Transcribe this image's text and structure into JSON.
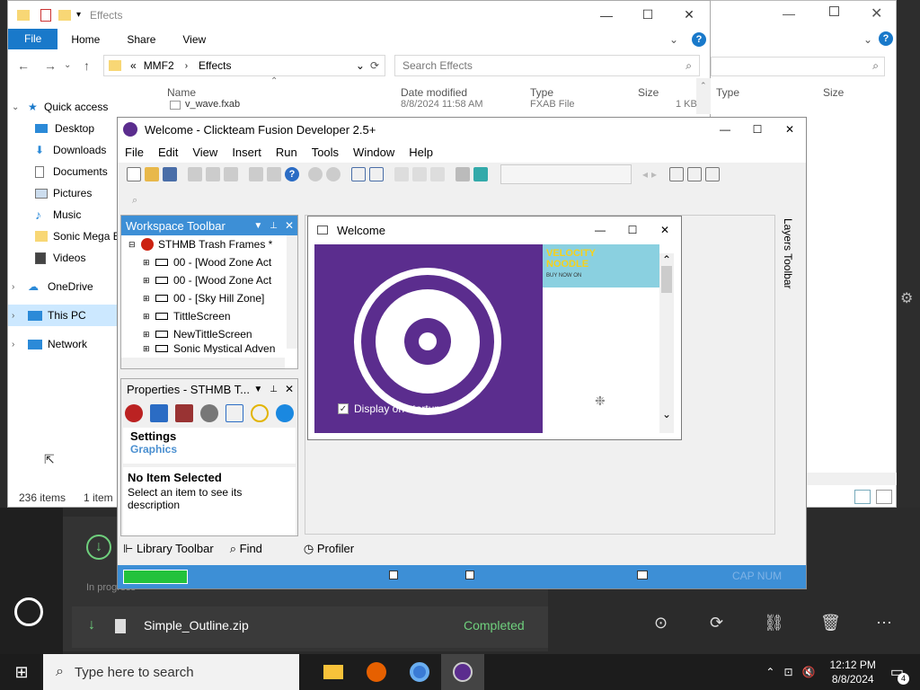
{
  "download_manager": {
    "in_progress_label": "In progress",
    "file_name": "Simple_Outline.zip",
    "status": "Completed",
    "status_color": "#6fd07d"
  },
  "explorer_back": {
    "col_type": "Type",
    "col_size": "Size"
  },
  "explorer": {
    "title": "Effects",
    "ribbon": {
      "file": "File",
      "home": "Home",
      "share": "Share",
      "view": "View"
    },
    "address": {
      "crumb_prefix": "«",
      "parts": [
        "MMF2",
        "Effects"
      ]
    },
    "search_placeholder": "Search Effects",
    "columns": {
      "name": "Name",
      "date": "Date modified",
      "type": "Type",
      "size": "Size"
    },
    "partial_row": {
      "name": "v_wave.fxab",
      "date": "8/8/2024 11:58 AM",
      "type": "FXAB File",
      "size": "1 KB"
    },
    "nav": [
      {
        "label": "Quick access",
        "icon": "star-icon"
      },
      {
        "label": "Desktop",
        "icon": "desktop-icon"
      },
      {
        "label": "Downloads",
        "icon": "downloads-icon"
      },
      {
        "label": "Documents",
        "icon": "documents-icon"
      },
      {
        "label": "Pictures",
        "icon": "pictures-icon"
      },
      {
        "label": "Music",
        "icon": "music-icon"
      },
      {
        "label": "Sonic Mega E",
        "icon": "folder-icon"
      },
      {
        "label": "Videos",
        "icon": "videos-icon"
      },
      {
        "label": "OneDrive",
        "icon": "onedrive-icon"
      },
      {
        "label": "This PC",
        "icon": "pc-icon"
      },
      {
        "label": "Network",
        "icon": "network-icon"
      }
    ],
    "status_items": "236 items",
    "status_selected": "1 item"
  },
  "fusion": {
    "title": "Welcome - Clickteam Fusion Developer 2.5+",
    "menu": [
      "File",
      "Edit",
      "View",
      "Insert",
      "Run",
      "Tools",
      "Window",
      "Help"
    ],
    "workspace_title": "Workspace Toolbar",
    "tree_root": "STHMB Trash Frames *",
    "tree_items": [
      "00 - [Wood Zone Act",
      "00 - [Wood Zone Act",
      "00 - [Sky Hill Zone]",
      "TittleScreen",
      "NewTittleScreen",
      "Sonic Mystical Adven"
    ],
    "properties_title": "Properties - STHMB T...",
    "prop_settings": "Settings",
    "prop_graphics": "Graphics",
    "prop_none_title": "No Item Selected",
    "prop_none_desc": "Select an item to see its description",
    "bottom_tabs": [
      "Library Toolbar",
      "Find",
      "Profiler"
    ],
    "layers_label": "Layers Toolbar",
    "status_caps": "CAP NUM",
    "welcome": {
      "title": "Welcome",
      "display_on_startup": "Display on startup",
      "ad_text": "VELOCITY NOODLE",
      "ad_sub": "BUY NOW ON"
    }
  },
  "taskbar": {
    "search_placeholder": "Type here to search",
    "time": "12:12 PM",
    "date": "8/8/2024",
    "notif_count": "4"
  }
}
